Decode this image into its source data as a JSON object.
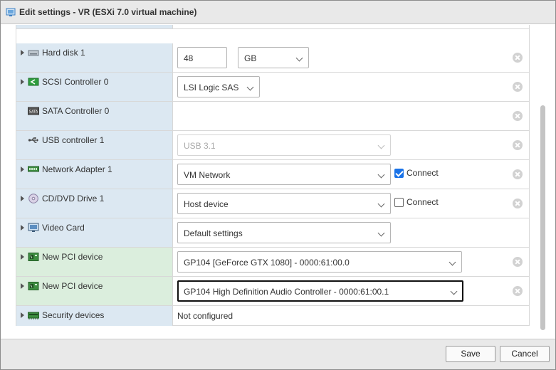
{
  "window": {
    "title": "Edit settings - VR (ESXi 7.0 virtual machine)"
  },
  "rows": [
    {
      "label": "",
      "icon": "blank-icon",
      "expandable": false,
      "controls": []
    },
    {
      "label": "Hard disk 1",
      "icon": "hard-disk-icon",
      "expandable": true,
      "input_value": "48",
      "select_value": "GB"
    },
    {
      "label": "SCSI Controller 0",
      "icon": "scsi-controller-icon",
      "expandable": true,
      "select_value": "LSI Logic SAS"
    },
    {
      "label": "SATA Controller 0",
      "icon": "sata-controller-icon",
      "expandable": false
    },
    {
      "label": "USB controller 1",
      "icon": "usb-icon",
      "expandable": false,
      "select_value": "USB 3.1",
      "disabled": true
    },
    {
      "label": "Network Adapter 1",
      "icon": "network-adapter-icon",
      "expandable": true,
      "select_value": "VM Network",
      "connect_label": "Connect",
      "connect_checked": true
    },
    {
      "label": "CD/DVD Drive 1",
      "icon": "cd-dvd-icon",
      "expandable": true,
      "select_value": "Host device",
      "connect_label": "Connect",
      "connect_checked": false
    },
    {
      "label": "Video Card",
      "icon": "video-card-icon",
      "expandable": true,
      "select_value": "Default settings"
    },
    {
      "label": "New PCI device",
      "icon": "pci-device-icon",
      "expandable": true,
      "select_value": "GP104 [GeForce GTX 1080] - 0000:61:00.0",
      "new": true
    },
    {
      "label": "New PCI device",
      "icon": "pci-device-icon",
      "expandable": true,
      "select_value": "GP104 High Definition Audio Controller - 0000:61:00.1",
      "new": true,
      "focused": true
    },
    {
      "label": "Security devices",
      "icon": "security-devices-icon",
      "expandable": true,
      "static_value": "Not configured"
    }
  ],
  "footer": {
    "save_label": "Save",
    "cancel_label": "Cancel"
  },
  "colors": {
    "label_bg": "#dce8f2",
    "new_device_bg": "#dbeedd",
    "checkbox_accent": "#1a73e8"
  }
}
